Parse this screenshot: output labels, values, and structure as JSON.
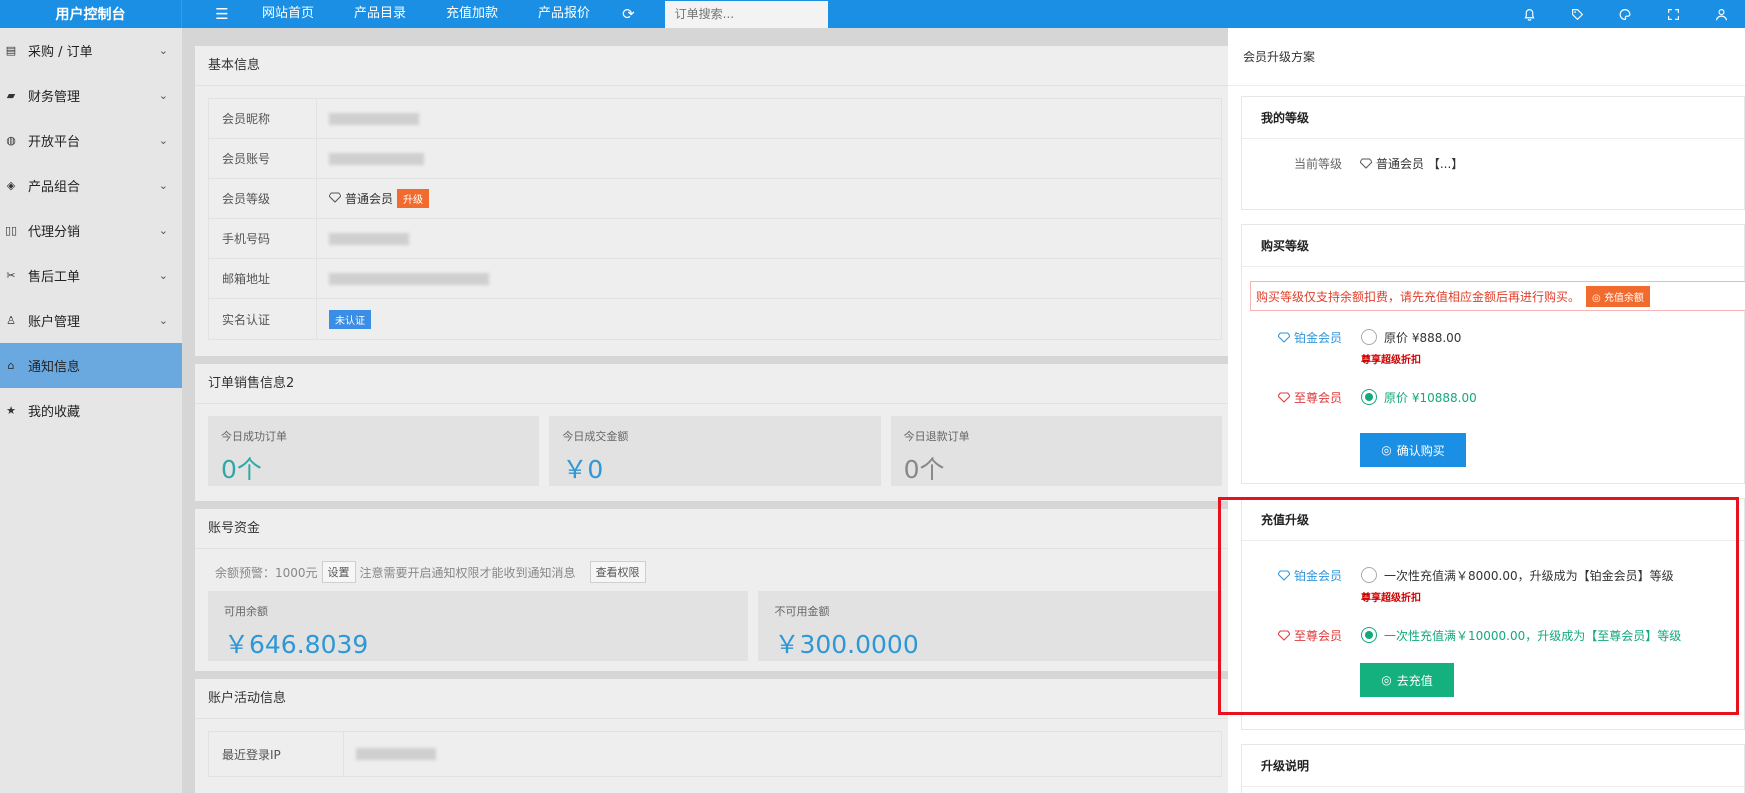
{
  "topbar": {
    "brand": "用户控制台",
    "menu_icon": "menu-icon",
    "nav": [
      "网站首页",
      "产品目录",
      "充值加款",
      "产品报价"
    ],
    "refresh_icon": "refresh-icon",
    "search_placeholder": "订单搜索...",
    "right_icons": [
      "bell-icon",
      "tag-icon",
      "palette-icon",
      "fullscreen-icon",
      "user-icon"
    ]
  },
  "sidebar": {
    "items": [
      {
        "label": "采购 / 订单",
        "icon": "order-icon",
        "chevron": "⌄"
      },
      {
        "label": "财务管理",
        "icon": "wallet-icon",
        "chevron": "⌄"
      },
      {
        "label": "开放平台",
        "icon": "globe-icon",
        "chevron": "⌄"
      },
      {
        "label": "产品组合",
        "icon": "cube-icon",
        "chevron": "⌄"
      },
      {
        "label": "代理分销",
        "icon": "columns-icon",
        "chevron": "⌄"
      },
      {
        "label": "售后工单",
        "icon": "tools-icon",
        "chevron": "⌄"
      },
      {
        "label": "账户管理",
        "icon": "user-icon",
        "chevron": "⌄"
      },
      {
        "label": "通知信息",
        "icon": "home-icon",
        "active": true
      },
      {
        "label": "我的收藏",
        "icon": "star-icon"
      }
    ]
  },
  "basic": {
    "title": "基本信息",
    "rows": {
      "nickname": "会员昵称",
      "account": "会员账号",
      "level": "会员等级",
      "phone": "手机号码",
      "email": "邮箱地址",
      "realname": "实名认证"
    },
    "level_value": "普通会员",
    "upgrade_badge": "升级",
    "verify_badge": "未认证"
  },
  "orders": {
    "title": "订单销售信息2",
    "stats": [
      {
        "label": "今日成功订单",
        "value": "0个"
      },
      {
        "label": "今日成交金额",
        "value": "￥0"
      },
      {
        "label": "今日退款订单",
        "value": "0个"
      }
    ]
  },
  "funds": {
    "title": "账号资金",
    "warn_prefix": "余额预警：1000元",
    "set_btn": "设置",
    "warn_text": "注意需要开启通知权限才能收到通知消息",
    "perm_btn": "查看权限",
    "available_label": "可用余额",
    "available_value": "￥646.8039",
    "frozen_label": "不可用金额",
    "frozen_value": "￥300.0000"
  },
  "activity": {
    "title": "账户活动信息",
    "ip_label": "最近登录IP"
  },
  "panel": {
    "title": "会员升级方案",
    "my_level": {
      "title": "我的等级",
      "label": "当前等级",
      "value": "普通会员 【...】"
    },
    "buy": {
      "title": "购买等级",
      "alert": "购买等级仅支持余额扣费，请先充值相应金额后再进行购买。",
      "alert_btn": "充值余额",
      "platinum": "铂金会员",
      "platinum_price": "原价 ¥888.00",
      "discount": "尊享超级折扣",
      "supreme": "至尊会员",
      "supreme_price": "原价 ¥10888.00",
      "confirm_btn": "确认购买"
    },
    "recharge": {
      "title": "充值升级",
      "platinum": "铂金会员",
      "platinum_text": "一次性充值满￥8000.00，升级成为【铂金会员】等级",
      "discount": "尊享超级折扣",
      "supreme": "至尊会员",
      "supreme_text": "一次性充值满￥10000.00，升级成为【至尊会员】等级",
      "go_btn": "去充值"
    },
    "explain": {
      "title": "升级说明"
    }
  },
  "colors": {
    "primary": "#1a8fe3",
    "green": "#14a87c",
    "highlight": "#e8121e"
  }
}
